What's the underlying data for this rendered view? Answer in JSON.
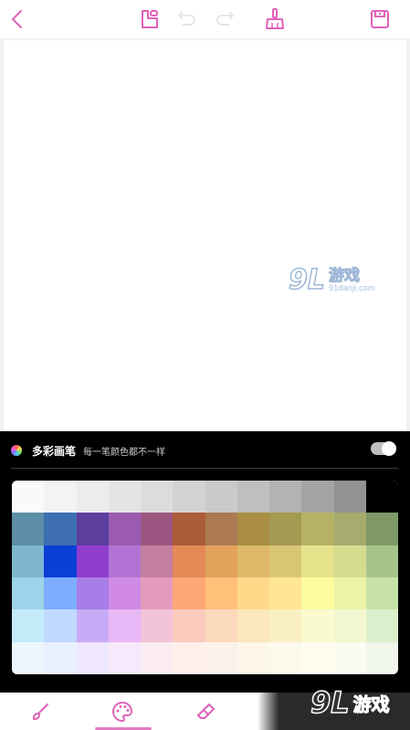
{
  "toolbar": {
    "icons": [
      "back-icon",
      "import-image-icon",
      "undo-icon",
      "redo-icon",
      "clear-broom-icon",
      "save-icon"
    ],
    "accent": "#e062b8",
    "disabled": "#e6e6e6"
  },
  "watermark": {
    "logo": "9L",
    "name": "游戏",
    "url": "91danji.com"
  },
  "brush_panel": {
    "title": "多彩画笔",
    "subtitle": "每一笔颜色都不一样",
    "toggle_on": true
  },
  "palette": {
    "rows": [
      [
        "#fafafa",
        "#f3f3f3",
        "#ececec",
        "#e4e4e4",
        "#dcdcdc",
        "#d3d3d3",
        "#cacaca",
        "#bfbfbf",
        "#b3b3b3",
        "#a4a4a4",
        "#929292",
        "#000000"
      ],
      [
        "#5e8fa8",
        "#3e6fb3",
        "#5c3e9e",
        "#9a5bb0",
        "#9b5781",
        "#ac5c38",
        "#ab7a52",
        "#a98e44",
        "#a49a52",
        "#b5b266",
        "#a6ab6e",
        "#7f9967"
      ],
      [
        "#7fb7cf",
        "#0a3fd8",
        "#8f3dce",
        "#b373d6",
        "#c47ea0",
        "#e38a57",
        "#e2a25c",
        "#dfb869",
        "#d8c675",
        "#e5e38b",
        "#d4dd8f",
        "#a7c48d"
      ],
      [
        "#9fd3ea",
        "#7dadff",
        "#a77de8",
        "#d08ae6",
        "#e49cbd",
        "#ffa677",
        "#ffc07a",
        "#ffd98a",
        "#ffe595",
        "#fdfb9e",
        "#ecf3a8",
        "#c7e2a8"
      ],
      [
        "#c4ebfa",
        "#c1d9ff",
        "#c8abf6",
        "#e9b8f6",
        "#f2c3d9",
        "#fbcbbd",
        "#fbd9bc",
        "#fbe6bd",
        "#f9efc3",
        "#fafad0",
        "#f2f7cf",
        "#dcefcd"
      ],
      [
        "#ecf7fc",
        "#e9f0ff",
        "#efe7fd",
        "#f7e9fb",
        "#fbecf2",
        "#fdefea",
        "#fdf2ea",
        "#fdf6ea",
        "#fdf9ec",
        "#fefdf0",
        "#fafcef",
        "#f0f6ec"
      ]
    ]
  },
  "bottom_bar": {
    "tabs": [
      "brush-icon",
      "palette-icon",
      "eraser-icon"
    ],
    "active": "palette-icon"
  }
}
